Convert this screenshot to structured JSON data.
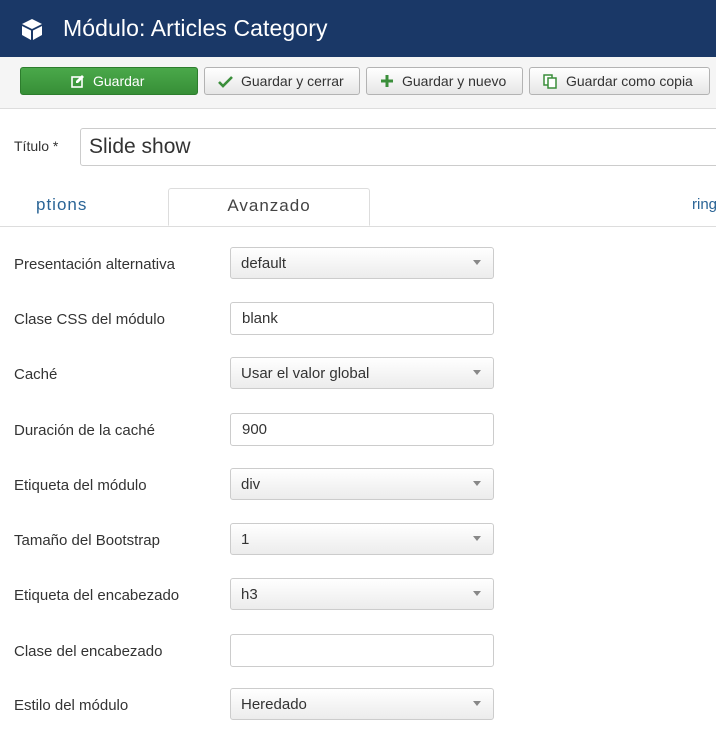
{
  "header": {
    "title": "Módulo: Articles Category",
    "icon": "cube-icon"
  },
  "toolbar": {
    "save": "Guardar",
    "save_close": "Guardar y cerrar",
    "save_new": "Guardar y nuevo",
    "save_copy": "Guardar como copia"
  },
  "title_field": {
    "label": "Título *",
    "value": "Slide show"
  },
  "tabs": {
    "prev": "ptions",
    "active": "Avanzado",
    "next": "ring"
  },
  "fields": {
    "layout": {
      "label": "Presentación alternativa",
      "value": "default"
    },
    "module_class": {
      "label": "Clase CSS del módulo",
      "value": "blank"
    },
    "cache": {
      "label": "Caché",
      "value": "Usar el valor global"
    },
    "cache_time": {
      "label": "Duración de la caché",
      "value": "900"
    },
    "module_tag": {
      "label": "Etiqueta del módulo",
      "value": "div"
    },
    "bootstrap_size": {
      "label": "Tamaño del Bootstrap",
      "value": "1"
    },
    "header_tag": {
      "label": "Etiqueta del encabezado",
      "value": "h3"
    },
    "header_class": {
      "label": "Clase del encabezado",
      "value": ""
    },
    "module_style": {
      "label": "Estilo del módulo",
      "value": "Heredado"
    }
  },
  "colors": {
    "header_bg": "#1a3867",
    "primary_btn": "#3f9b3f",
    "link": "#2a6496"
  }
}
